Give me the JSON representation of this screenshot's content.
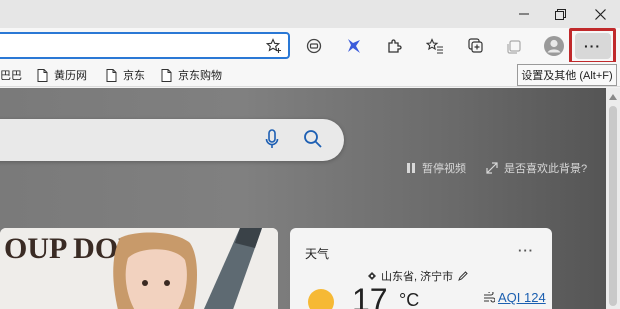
{
  "window": {
    "minimize_icon": "minimize-icon",
    "restore_icon": "restore-icon",
    "close_icon": "close-icon"
  },
  "toolbar": {
    "address_value": "",
    "favorite_icon": "star-add-icon",
    "buttons": [
      "tracking-icon",
      "bing-icon",
      "extensions-icon",
      "favorites-icon",
      "collections-icon",
      "workspace-icon",
      "profile-icon"
    ],
    "more_label": "···"
  },
  "tooltip": {
    "text": "设置及其他 (Alt+F)"
  },
  "bookmarks": [
    {
      "label": "巴巴"
    },
    {
      "label": "黄历网"
    },
    {
      "label": "京东"
    },
    {
      "label": "京东购物"
    }
  ],
  "content": {
    "pause_label": "暂停视频",
    "like_label": "是否喜欢此背景?",
    "card_image_text": "OUP DOE",
    "weather": {
      "title": "天气",
      "more_label": "···",
      "location": "山东省, 济宁市",
      "temperature": "17",
      "unit": "°C",
      "aqi": "AQI 124"
    }
  },
  "colors": {
    "highlight_border": "#c0292b",
    "address_focus": "#2a78d5",
    "aqi_link": "#1b5fb0",
    "sun": "#f6b935"
  }
}
